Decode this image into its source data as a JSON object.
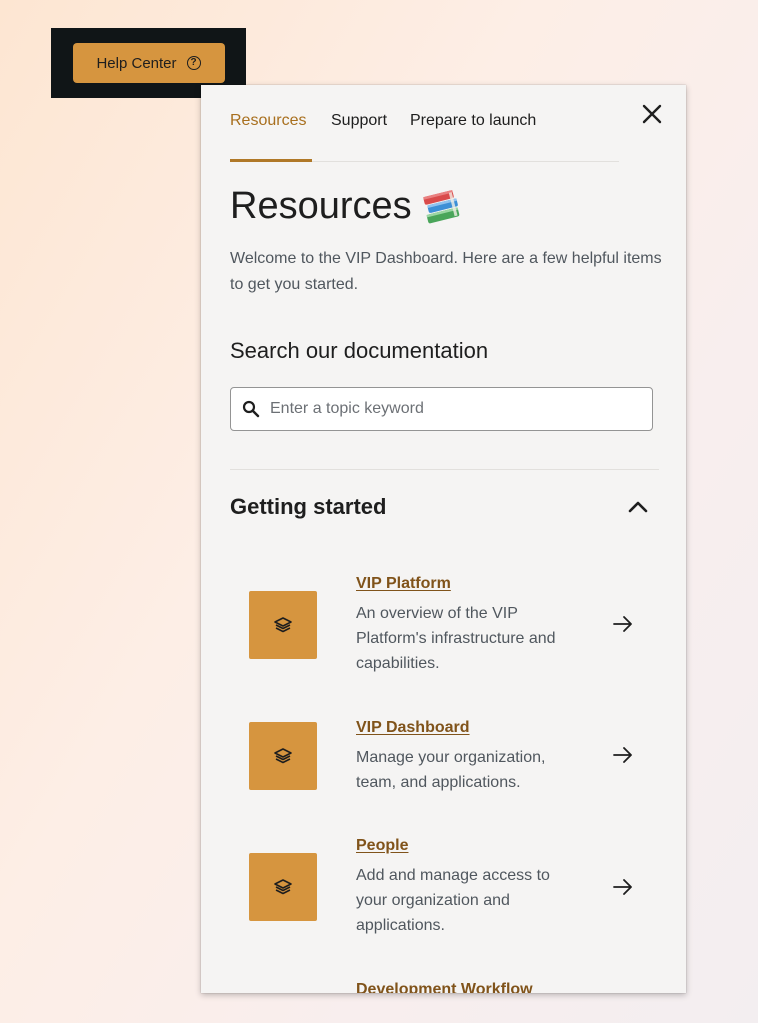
{
  "launcher": {
    "label": "Help Center",
    "icon": "question-circle-icon"
  },
  "tabs": [
    {
      "label": "Resources",
      "active": true
    },
    {
      "label": "Support",
      "active": false
    },
    {
      "label": "Prepare to launch",
      "active": false
    }
  ],
  "page": {
    "title": "Resources",
    "title_emoji": "books-icon",
    "intro": "Welcome to the VIP Dashboard. Here are a few helpful items to get you started."
  },
  "search": {
    "title": "Search our documentation",
    "placeholder": "Enter a topic keyword",
    "value": ""
  },
  "section": {
    "title": "Getting started",
    "expanded": true
  },
  "items": [
    {
      "title": "VIP Platform",
      "description": "An overview of the VIP Platform's infrastructure and capabilities.",
      "icon": "layers-icon"
    },
    {
      "title": "VIP Dashboard",
      "description": "Manage your organization, team, and applications.",
      "icon": "layers-icon"
    },
    {
      "title": "People",
      "description": "Add and manage access to your organization and applications.",
      "icon": "layers-icon"
    },
    {
      "title": "Development Workflow",
      "description": "",
      "icon": "layers-icon"
    }
  ],
  "colors": {
    "accent": "#d6953f",
    "link": "#80531a",
    "active_tab": "#a86f1e",
    "launcher_bg": "#101517"
  }
}
